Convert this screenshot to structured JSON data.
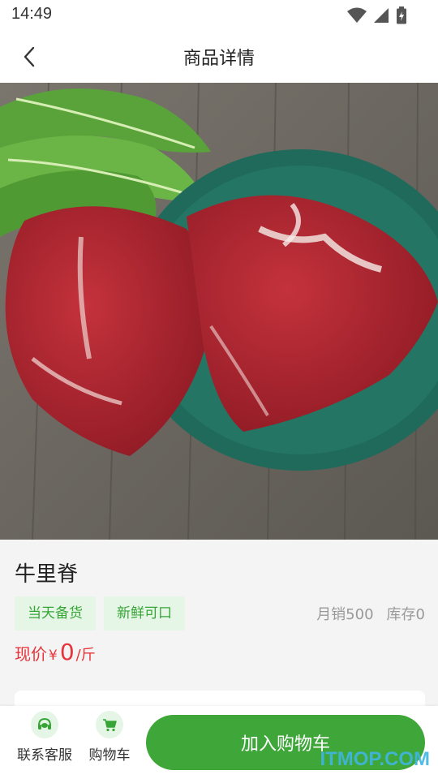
{
  "status_bar": {
    "time": "14:49",
    "icons": [
      "wifi-icon",
      "signal-icon",
      "battery-charging-icon"
    ]
  },
  "header": {
    "title": "商品详情",
    "back_icon": "chevron-left-icon"
  },
  "product": {
    "name": "牛里脊",
    "tags": [
      "当天备货",
      "新鲜可口"
    ],
    "monthly_sales": "月销500",
    "stock": "库存0",
    "price_label": "现价",
    "currency": "¥",
    "price": "0",
    "unit": "/斤",
    "image_count": 1,
    "current_image": 1
  },
  "bottom_bar": {
    "service_label": "联系客服",
    "cart_label": "购物车",
    "add_to_cart": "加入购物车"
  },
  "watermark": "ITMOP.COM",
  "colors": {
    "accent": "#3fa73a",
    "tag_bg": "#e6f6e6",
    "tag_text": "#36a536",
    "price": "#e8333a"
  }
}
